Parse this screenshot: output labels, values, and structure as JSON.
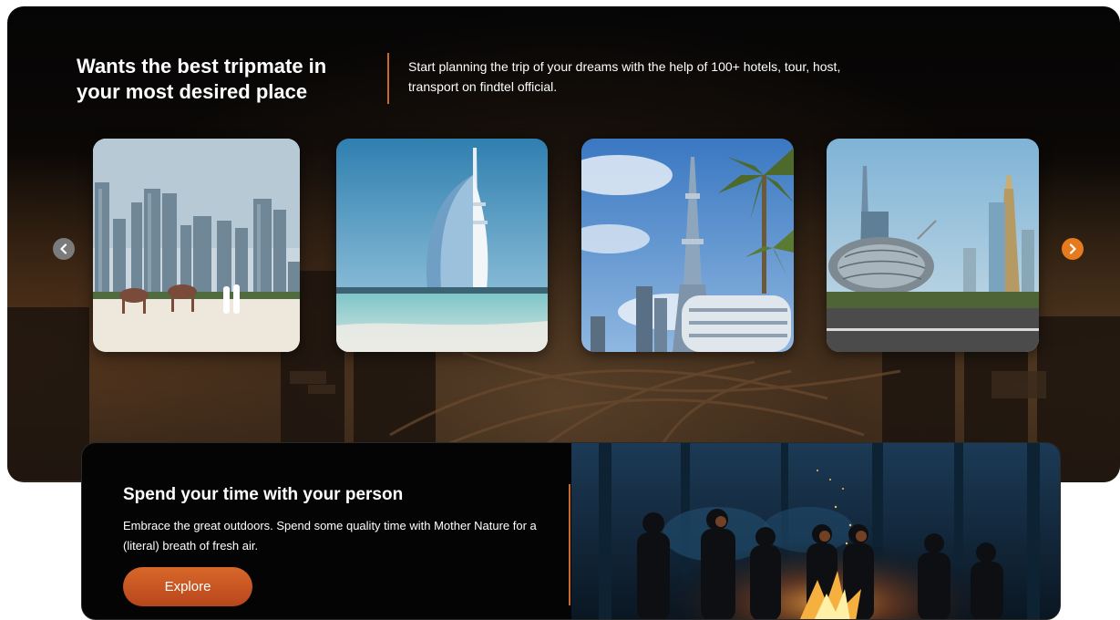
{
  "hero": {
    "title": "Wants the best tripmate in your most desired place",
    "description": "Start planning the trip of your dreams with the help of 100+ hotels, tour, host, transport on findtel official.",
    "background_icon": "city-highway-background",
    "prev_icon": "chevron-left-icon",
    "next_icon": "chevron-right-icon",
    "accent_color": "#e67a1f",
    "cards": [
      {
        "name": "beach-camels-skyline-photo"
      },
      {
        "name": "sail-hotel-photo"
      },
      {
        "name": "tower-palm-photo"
      },
      {
        "name": "museum-skyline-photo"
      }
    ]
  },
  "promo": {
    "title": "Spend your time with your person",
    "description": "Embrace the great outdoors. Spend some quality time with Mother Nature for a (literal) breath of fresh air.",
    "explore_label": "Explore",
    "photo": "campfire-friends-photo",
    "button_color": "#c9521f"
  }
}
